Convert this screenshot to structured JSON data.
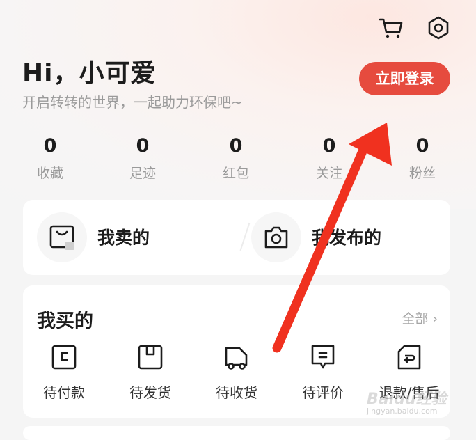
{
  "header": {
    "greeting": "Hi，小可爱",
    "subtitle": "开启转转的世界，一起助力环保吧~",
    "login_label": "立即登录",
    "icons": [
      "cart-icon",
      "settings-icon"
    ]
  },
  "stats": [
    {
      "value": "0",
      "label": "收藏"
    },
    {
      "value": "0",
      "label": "足迹"
    },
    {
      "value": "0",
      "label": "红包"
    },
    {
      "value": "0",
      "label": "关注"
    },
    {
      "value": "0",
      "label": "粉丝"
    }
  ],
  "sell_card": {
    "my_sold": "我卖的",
    "my_published": "我发布的"
  },
  "buy_card": {
    "title": "我买的",
    "all_label": "全部 ›",
    "items": [
      {
        "label": "待付款",
        "icon": "wallet-icon"
      },
      {
        "label": "待发货",
        "icon": "package-icon"
      },
      {
        "label": "待收货",
        "icon": "truck-icon"
      },
      {
        "label": "待评价",
        "icon": "comment-icon"
      },
      {
        "label": "退款/售后",
        "icon": "refund-icon"
      }
    ]
  },
  "colors": {
    "accent": "#e64b3e",
    "arrow": "#f0311f",
    "text_primary": "#1c1c1c",
    "text_secondary": "#9a9a9a"
  },
  "watermark": {
    "text": "Baidu经验",
    "sub": "jingyan.baidu.com"
  }
}
